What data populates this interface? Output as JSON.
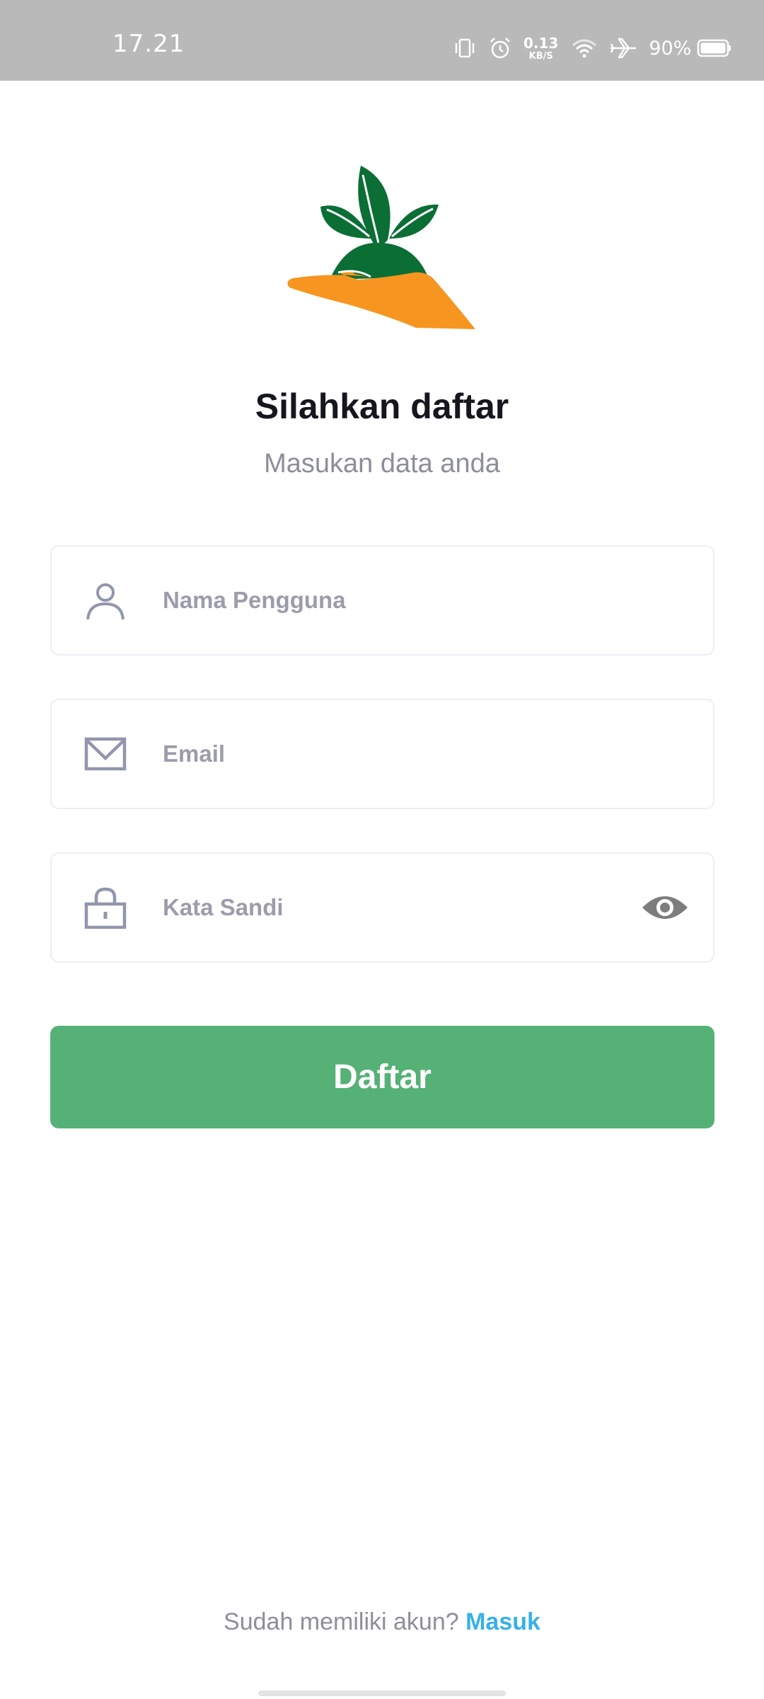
{
  "status_bar": {
    "time": "17.21",
    "net_speed_value": "0.13",
    "net_speed_unit": "KB/S",
    "battery_percent": "90%"
  },
  "header": {
    "title": "Silahkan daftar",
    "subtitle": "Masukan data anda"
  },
  "form": {
    "username_placeholder": "Nama Pengguna",
    "email_placeholder": "Email",
    "password_placeholder": "Kata Sandi",
    "submit_label": "Daftar"
  },
  "footer": {
    "prompt": "Sudah memiliki akun? ",
    "link_label": "Masuk"
  },
  "colors": {
    "primary": "#55b176",
    "link": "#37b1e8",
    "logo_green": "#0b6e35",
    "logo_orange": "#f6951f"
  },
  "icons": [
    "vibrate-icon",
    "alarm-icon",
    "wifi-icon",
    "airplane-icon",
    "battery-icon",
    "user-icon",
    "mail-icon",
    "lock-icon",
    "eye-icon"
  ]
}
